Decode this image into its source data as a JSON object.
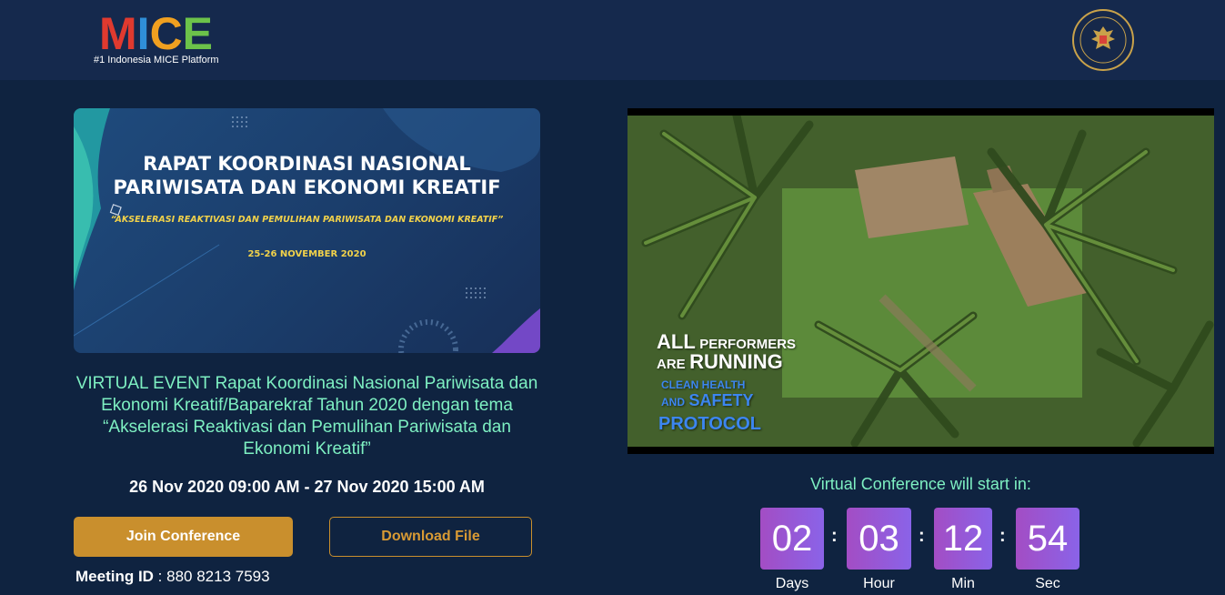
{
  "header": {
    "logo_letters": [
      {
        "char": "M",
        "color": "#e03a2f"
      },
      {
        "char": "I",
        "color": "#2f8fd8"
      },
      {
        "char": "C",
        "color": "#f0a020"
      },
      {
        "char": "E",
        "color": "#6cc24a"
      }
    ],
    "tagline": "#1 Indonesia MICE Platform",
    "seal_icon": "garuda-seal-icon",
    "seal_text": "KEMENTERIAN PARIWISATA DAN EKONOMI KREATIF REPUBLIK INDONESIA"
  },
  "banner": {
    "title_line1": "RAPAT KOORDINASI NASIONAL",
    "title_line2": "PARIWISATA DAN EKONOMI KREATIF",
    "subtitle": "“AKSELERASI REAKTIVASI DAN PEMULIHAN PARIWISATA DAN EKONOMI KREATIF”",
    "date": "25-26 NOVEMBER 2020"
  },
  "event": {
    "description": "VIRTUAL EVENT Rapat Koordinasi Nasional Pariwisata dan Ekonomi Kreatif/Baparekraf Tahun 2020 dengan tema “Akselerasi Reaktivasi dan Pemulihan Pariwisata dan Ekonomi Kreatif”",
    "time": "26 Nov 2020 09:00 AM - 27 Nov 2020 15:00 AM",
    "join_label": "Join Conference",
    "download_label": "Download File",
    "meeting_id_label": "Meeting ID",
    "meeting_id_sep": " : ",
    "meeting_id_value": "880 8213 7593"
  },
  "video": {
    "line1_big": "ALL",
    "line1_small": "PERFORMERS",
    "line2_small": "ARE",
    "line2_big": "RUNNING",
    "line3": "CLEAN HEALTH",
    "line4_small": "AND",
    "line4_big": "SAFETY",
    "line5": "PROTOCOL"
  },
  "countdown": {
    "label": "Virtual Conference will start in:",
    "days": "02",
    "hours": "03",
    "minutes": "12",
    "seconds": "54",
    "days_label": "Days",
    "hours_label": "Hour",
    "minutes_label": "Min",
    "seconds_label": "Sec",
    "separator": ":"
  },
  "colors": {
    "page_bg": "#0f2340",
    "topbar_bg": "#15294d",
    "accent_gold": "#c98f2d",
    "mint_text": "#7ef0c2"
  }
}
